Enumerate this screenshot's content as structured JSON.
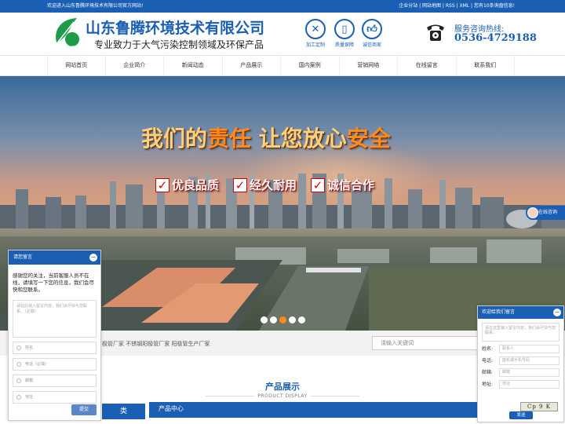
{
  "topbar": {
    "welcome": "欢迎进入山东鲁腾环境技术有限公司官方网站!",
    "links": "企业分站 | 网站地图 | RSS | XML | 您有10条询盘信息!"
  },
  "header": {
    "logo_text": "鲁腾",
    "company_name": "山东鲁腾环境技术有限公司",
    "slogan": "专业致力于大气污染控制领域及环保产品",
    "badges": [
      {
        "label": "加工定制",
        "icon": "wrench-icon"
      },
      {
        "label": "质量保障",
        "icon": "shield-icon"
      },
      {
        "label": "诚信商家",
        "icon": "thumbs-up-icon"
      }
    ],
    "hotline_label": "服务咨询热线:",
    "hotline_number": "0536-4729188"
  },
  "nav": {
    "items": [
      "网站首页",
      "企业简介",
      "新闻动态",
      "产品展示",
      "国内案例",
      "营销网络",
      "在线留言",
      "联系我们"
    ]
  },
  "banner": {
    "headline_1": "我们的",
    "headline_2": "责任",
    "headline_3": " 让您放心",
    "headline_4": "安全",
    "features": [
      "优良品质",
      "经久耐用",
      "诚信合作"
    ],
    "slide_count": 5,
    "active_slide": 3
  },
  "search": {
    "hot_keywords": "极管厂家  不锈钢阳极管厂家  阳极管生产厂家",
    "placeholder": "请输入关键词"
  },
  "products": {
    "title": "产品展示",
    "subtitle": "PRODUCT DISPLAY",
    "category_head": "类",
    "center_head": "产品中心"
  },
  "side_consult": {
    "label": "在线咨询"
  },
  "chat_left": {
    "title": "请您留言",
    "minimize": "−",
    "message": "感谢您的关注，当前客服人员不在线，请填写一下您的信息，我们会尽快和您联系。",
    "textarea_placeholder": "请在此输入留言内容，我们会尽快与您联系。（必填）",
    "fields": [
      "姓名",
      "电话（必填）",
      "邮箱",
      "地址"
    ],
    "submit": "提交"
  },
  "chat_right": {
    "title": "欢迎给我们留言",
    "minimize": "−",
    "textarea_placeholder": "请在这里输入留言内容，我们会尽快与您联系。",
    "fields": [
      {
        "label": "姓名:",
        "placeholder": "联系人"
      },
      {
        "label": "电话:",
        "placeholder": "座机或手机号码"
      },
      {
        "label": "邮箱:",
        "placeholder": "邮箱"
      },
      {
        "label": "地址:",
        "placeholder": "地址"
      }
    ],
    "submit": "发送"
  },
  "captcha": {
    "text": "Cp 9 K"
  }
}
